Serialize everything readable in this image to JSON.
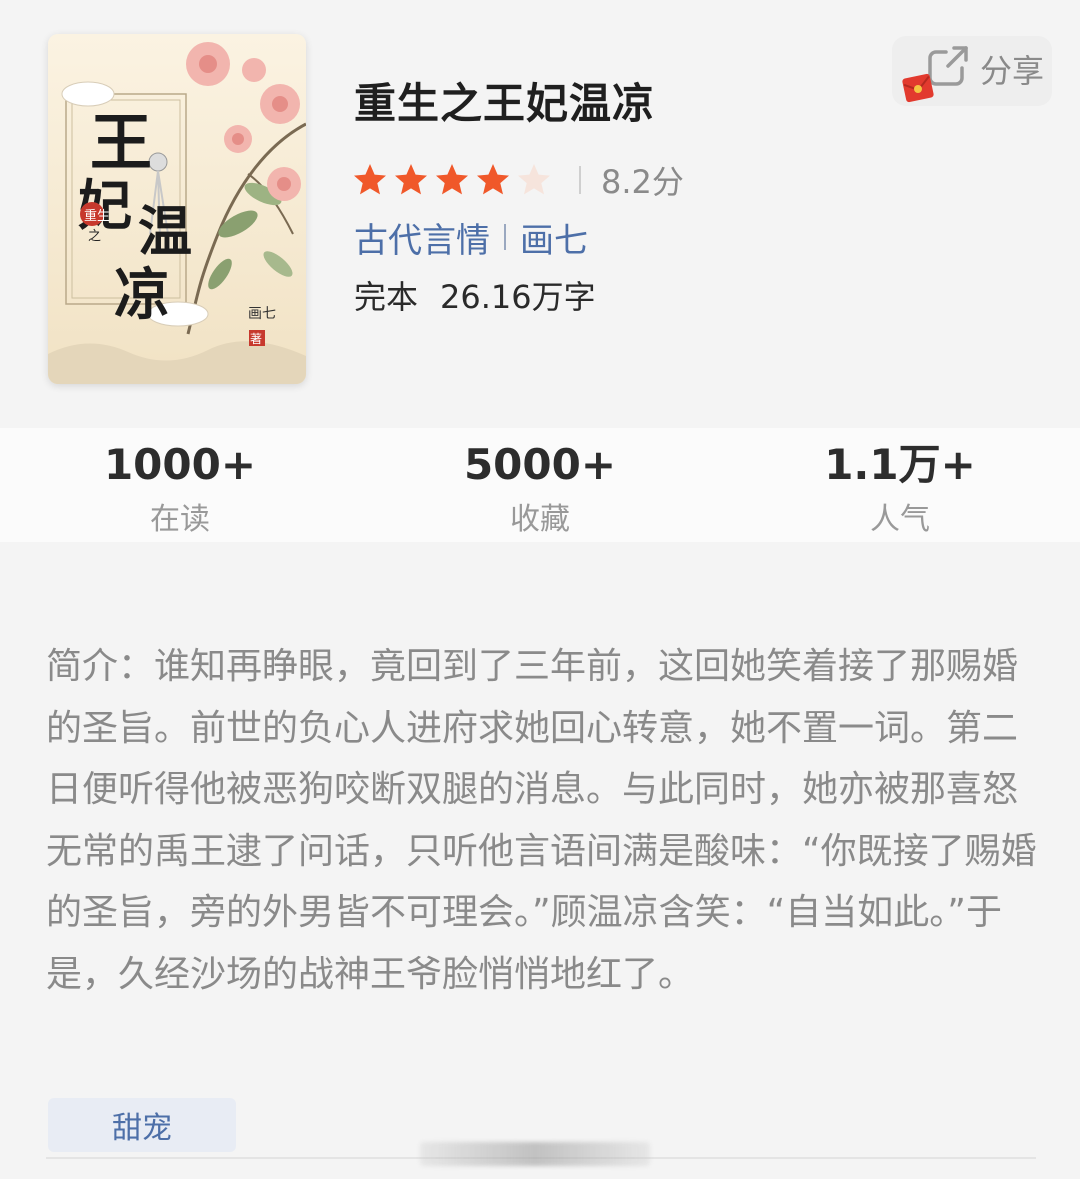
{
  "book": {
    "title": "重生之王妃温凉",
    "rating": {
      "stars_filled": 4,
      "stars_total": 5,
      "score_text": "8.2分"
    },
    "category": "古代言情",
    "author": "画七",
    "status": "完本",
    "word_count": "26.16万字",
    "cover": {
      "title_text": "王妃温凉",
      "subtitle_text": "重生之",
      "author_text": "画七",
      "seal_text": "著"
    }
  },
  "share": {
    "label": "分享"
  },
  "stats": [
    {
      "value": "1000+",
      "label": "在读"
    },
    {
      "value": "5000+",
      "label": "收藏"
    },
    {
      "value": "1.1万+",
      "label": "人气"
    }
  ],
  "intro": {
    "text": "简介：谁知再睁眼，竟回到了三年前，这回她笑着接了那赐婚的圣旨。前世的负心人进府求她回心转意，她不置一词。第二日便听得他被恶狗咬断双腿的消息。与此同时，她亦被那喜怒无常的禹王逮了问话，只听他言语间满是酸味：“你既接了赐婚的圣旨，旁的外男皆不可理会。”顾温凉含笑：“自当如此。”于是，久经沙场的战神王爷脸悄悄地红了。"
  },
  "tags": [
    "甜宠"
  ],
  "colors": {
    "star_filled": "#f0582a",
    "star_empty": "#f6e4dc",
    "link": "#4d6fa8",
    "intro_text": "#8a8a8a"
  }
}
